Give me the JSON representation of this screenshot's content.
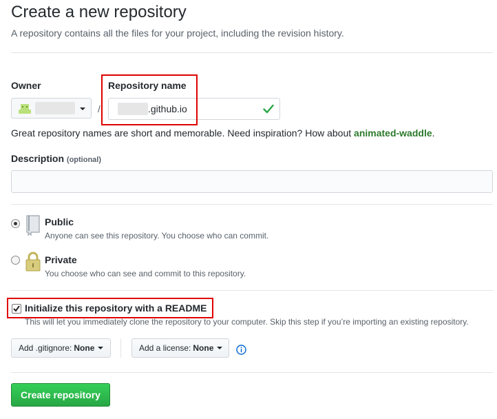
{
  "page": {
    "title": "Create a new repository",
    "subtitle": "A repository contains all the files for your project, including the revision history."
  },
  "owner": {
    "label": "Owner"
  },
  "repo": {
    "label": "Repository name",
    "value": ".github.io",
    "separator": "/"
  },
  "hint": {
    "text": "Great repository names are short and memorable. Need inspiration? How about ",
    "suggestion": "animated-waddle",
    "end": "."
  },
  "description": {
    "label": "Description",
    "optional": "(optional)",
    "value": ""
  },
  "visibility": {
    "selected": "public",
    "public": {
      "title": "Public",
      "desc": "Anyone can see this repository. You choose who can commit."
    },
    "private": {
      "title": "Private",
      "desc": "You choose who can see and commit to this repository."
    }
  },
  "readme": {
    "checked": true,
    "label": "Initialize this repository with a README",
    "desc": "This will let you immediately clone the repository to your computer. Skip this step if you’re importing an existing repository."
  },
  "gitignore": {
    "prefix": "Add .gitignore:",
    "value": "None"
  },
  "license": {
    "prefix": "Add a license:",
    "value": "None"
  },
  "submit": {
    "label": "Create repository"
  },
  "colors": {
    "accent": "#28a745",
    "highlight": "#e00000",
    "suggestion": "#2c7a2c"
  }
}
